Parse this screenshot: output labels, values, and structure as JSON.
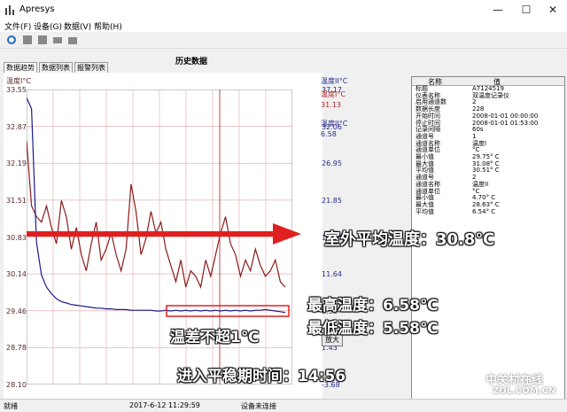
{
  "window": {
    "title": "Apresys",
    "minimize": "—",
    "maximize": "☐",
    "close": "✕"
  },
  "menu": [
    "文件(F)",
    "设备(G)",
    "数据(V)",
    "帮助(H)"
  ],
  "panel_title": "历史数据",
  "tabs": [
    "数据趋势",
    "数据列表",
    "报警列表"
  ],
  "chart": {
    "left_unit": "温度I°C",
    "right_unit": "温度II°C",
    "left_ticks": [
      "33.55",
      "32.87",
      "32.19",
      "31.51",
      "30.83",
      "30.14",
      "29.46",
      "28.78",
      "28.10"
    ],
    "right_ticks": [
      "37.17",
      "32.06",
      "26.95",
      "21.85",
      "16.74",
      "11.64",
      "6.53",
      "1.43",
      "-3.68"
    ],
    "legend_s1_label": "温度I°C",
    "legend_s1_value": "31.13",
    "legend_s2_label": "温度II°C",
    "legend_s2_value": "6.58"
  },
  "chart_data": {
    "type": "line",
    "ylim_left": [
      28.1,
      33.55
    ],
    "ylim_right": [
      -3.68,
      37.17
    ],
    "series": [
      {
        "name": "温度I°C",
        "axis": "left",
        "color": "#8b1a1a",
        "values": [
          32.6,
          31.4,
          31.2,
          31.1,
          31.4,
          31.0,
          30.7,
          31.5,
          31.2,
          30.6,
          31.0,
          30.5,
          30.2,
          30.7,
          31.1,
          30.4,
          30.6,
          30.9,
          30.5,
          30.2,
          30.6,
          31.8,
          31.3,
          30.5,
          30.8,
          31.3,
          30.9,
          31.1,
          30.6,
          30.3,
          30.0,
          30.4,
          29.9,
          30.2,
          30.1,
          29.9,
          30.4,
          30.1,
          30.5,
          30.9,
          31.2,
          30.7,
          30.5,
          30.1,
          30.4,
          30.2,
          30.6,
          30.3,
          30.1,
          30.2,
          30.4,
          30.0,
          29.9
        ]
      },
      {
        "name": "温度II°C",
        "axis": "right",
        "color": "#1a1a8b",
        "values": [
          36.0,
          34.5,
          16.0,
          11.5,
          9.8,
          8.9,
          8.2,
          7.8,
          7.6,
          7.4,
          7.3,
          7.2,
          7.1,
          7.0,
          6.9,
          6.9,
          6.8,
          6.8,
          6.7,
          6.7,
          6.7,
          6.6,
          6.6,
          6.6,
          6.6,
          6.6,
          6.5,
          6.5,
          6.6,
          6.5,
          6.6,
          6.5,
          6.6,
          6.5,
          6.6,
          6.5,
          6.6,
          6.5,
          6.6,
          6.5,
          6.6,
          6.5,
          6.6,
          6.5,
          6.6,
          6.5,
          6.6,
          6.6,
          6.7,
          6.6,
          6.5,
          6.4,
          6.3
        ]
      }
    ]
  },
  "zoom_button": "放大",
  "table": {
    "headers": [
      "名称",
      "值"
    ],
    "rows": [
      [
        "标题",
        "A7124519"
      ],
      [
        "仪表名称",
        "双温度记录仪"
      ],
      [
        "启用通道数",
        "2"
      ],
      [
        "数据长度",
        "228"
      ],
      [
        "开始时间",
        "2008-01-01 00:00:00"
      ],
      [
        "停止时间",
        "2008-01-01 01:53:00"
      ],
      [
        "记录间隔",
        "60s"
      ],
      [
        "通道号",
        "1"
      ],
      [
        "通道名称",
        "温度I"
      ],
      [
        "通道单位",
        "°C"
      ],
      [
        "最小值",
        "29.75° C"
      ],
      [
        "最大值",
        "31.08° C"
      ],
      [
        "平均值",
        "30.51° C"
      ],
      [
        "通道号",
        "2"
      ],
      [
        "通道名称",
        "温度II"
      ],
      [
        "通道单位",
        "°C"
      ],
      [
        "最小值",
        "4.70° C"
      ],
      [
        "最大值",
        "28.63° C"
      ],
      [
        "平均值",
        "6.54° C"
      ]
    ]
  },
  "status": {
    "ready": "就绪",
    "time": "2017-6-12 11:29:59",
    "device": "设备未连接"
  },
  "annotations": {
    "outdoor_avg": "室外平均温度：30.8℃",
    "max_temp": "最高温度：6.58℃",
    "min_temp": "最低温度：5.58℃",
    "diff": "温差不超1℃",
    "stable_time": "进入平稳期时间：14:56"
  },
  "watermark": {
    "line1": "中关村在线",
    "line2": "ZOL.COM.CN"
  }
}
